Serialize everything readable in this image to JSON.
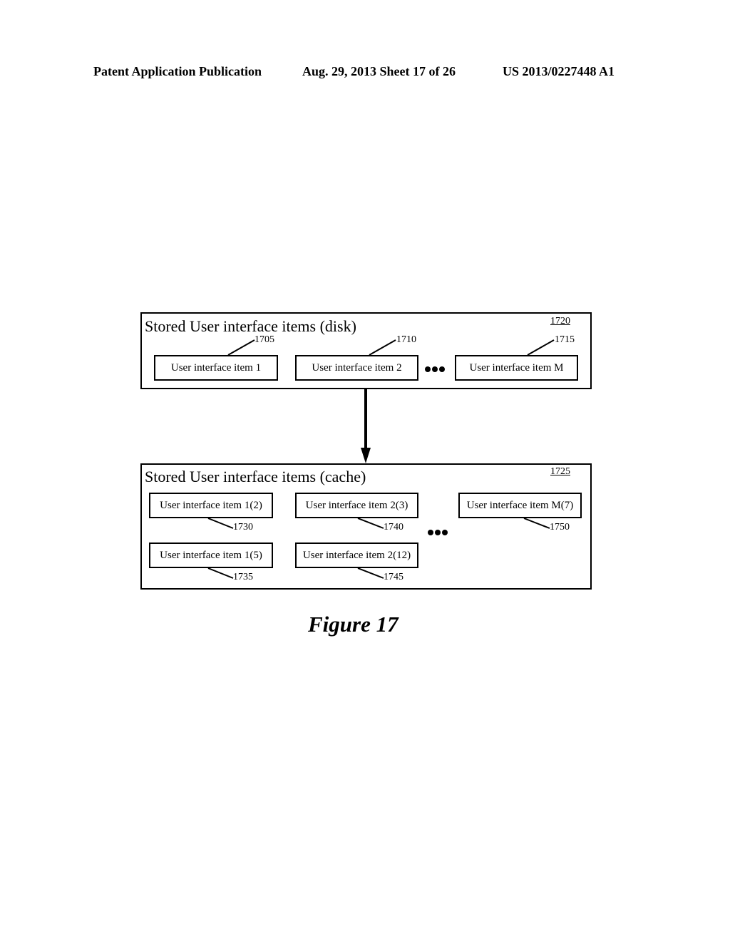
{
  "header": {
    "publication": "Patent Application Publication",
    "date_sheet": "Aug. 29, 2013  Sheet 17 of 26",
    "number": "US 2013/0227448 A1"
  },
  "disk": {
    "title": "Stored User interface items (disk)",
    "ref": "1720",
    "items": [
      {
        "label": "User interface item 1",
        "ref": "1705"
      },
      {
        "label": "User interface item 2",
        "ref": "1710"
      },
      {
        "label": "User interface item M",
        "ref": "1715"
      }
    ]
  },
  "cache": {
    "title": "Stored User interface items (cache)",
    "ref": "1725",
    "items": [
      {
        "label": "User interface item 1(2)",
        "ref": "1730"
      },
      {
        "label": "User interface item 1(5)",
        "ref": "1735"
      },
      {
        "label": "User interface item 2(3)",
        "ref": "1740"
      },
      {
        "label": "User interface item 2(12)",
        "ref": "1745"
      },
      {
        "label": "User interface item M(7)",
        "ref": "1750"
      }
    ]
  },
  "figure": {
    "caption": "Figure 17"
  }
}
